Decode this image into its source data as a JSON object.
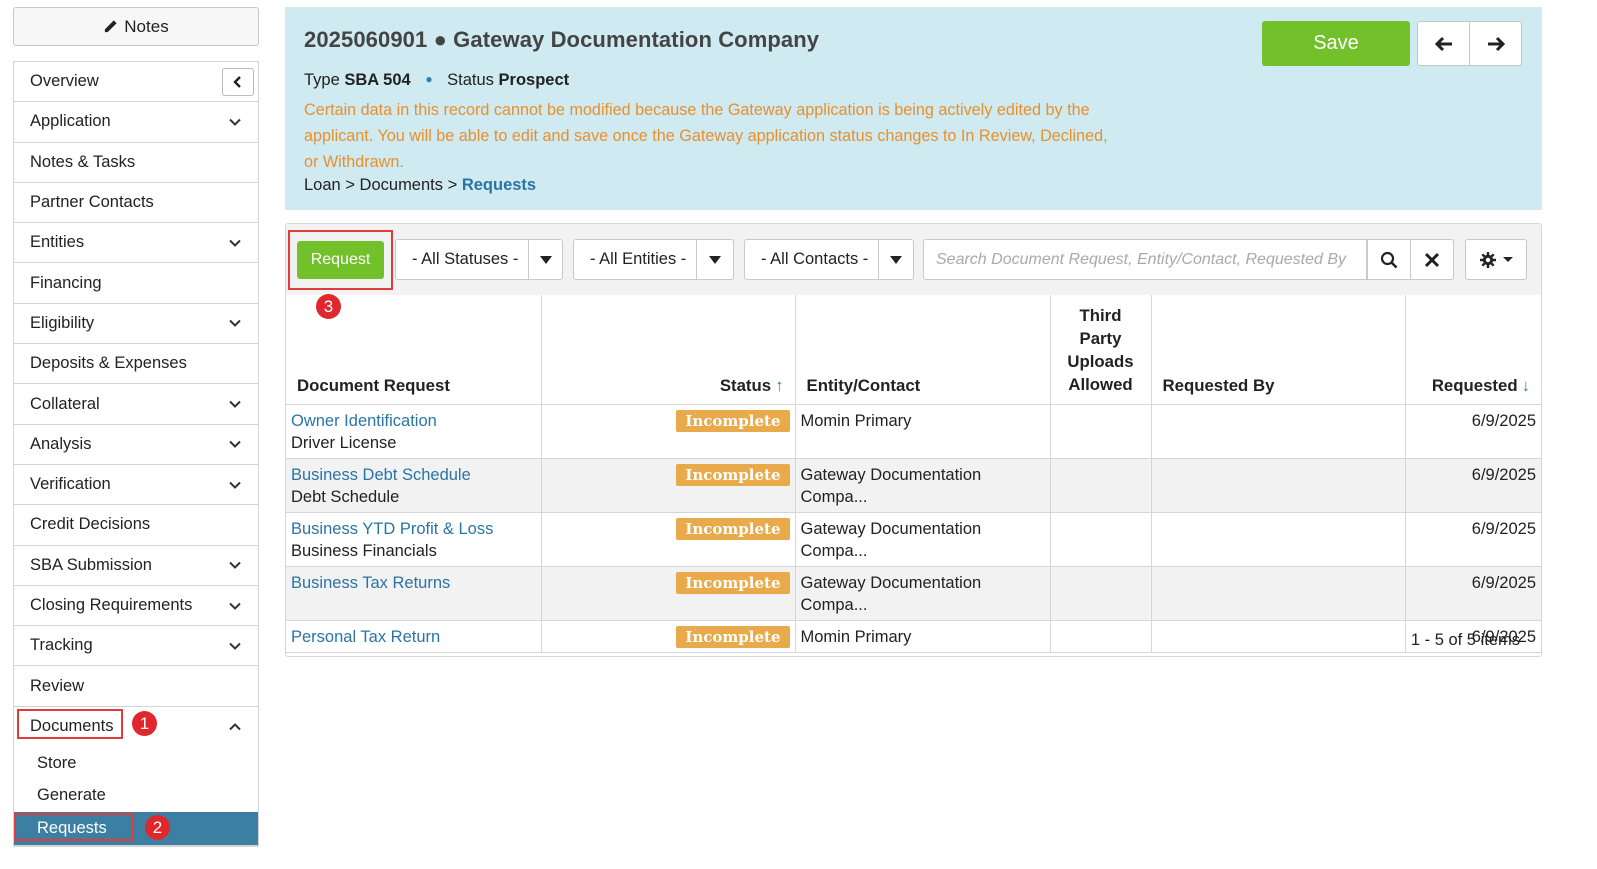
{
  "sidebar": {
    "notes_label": "Notes",
    "items": [
      {
        "label": "Overview"
      },
      {
        "label": "Application"
      },
      {
        "label": "Notes & Tasks"
      },
      {
        "label": "Partner Contacts"
      },
      {
        "label": "Entities"
      },
      {
        "label": "Financing"
      },
      {
        "label": "Eligibility"
      },
      {
        "label": "Deposits & Expenses"
      },
      {
        "label": "Collateral"
      },
      {
        "label": "Analysis"
      },
      {
        "label": "Verification"
      },
      {
        "label": "Credit Decisions"
      },
      {
        "label": "SBA Submission"
      },
      {
        "label": "Closing Requirements"
      },
      {
        "label": "Tracking"
      },
      {
        "label": "Review"
      },
      {
        "label": "Documents"
      }
    ],
    "documents_sub": [
      {
        "label": "Store"
      },
      {
        "label": "Generate"
      },
      {
        "label": "Requests"
      }
    ]
  },
  "annotations": {
    "one": "1",
    "two": "2",
    "three": "3"
  },
  "header": {
    "title": "2025060901 ● Gateway Documentation Company",
    "type_label": "Type",
    "type_value": "SBA 504",
    "status_label": "Status",
    "status_value": "Prospect",
    "warning": "Certain data in this record cannot be modified because the Gateway application is being actively edited by the applicant. You will be able to edit and save once the Gateway application status changes to In Review, Declined, or Withdrawn.",
    "breadcrumb": {
      "part1": "Loan",
      "sep": ">",
      "part2": "Documents",
      "current": "Requests"
    },
    "save_label": "Save"
  },
  "toolbar": {
    "request_label": "Request",
    "statuses_label": "- All Statuses -",
    "entities_label": "- All Entities -",
    "contacts_label": "- All Contacts -",
    "search_placeholder": "Search Document Request, Entity/Contact, Requested By"
  },
  "table": {
    "headers": {
      "document_request": "Document Request",
      "status": "Status",
      "entity_contact": "Entity/Contact",
      "third_party_1": "Third",
      "third_party_2": "Party",
      "third_party_3": "Uploads",
      "third_party_4": "Allowed",
      "requested_by": "Requested By",
      "requested": "Requested"
    },
    "rows": [
      {
        "title": "Owner Identification",
        "subtitle": "Driver License",
        "status": "Incomplete",
        "entity": "Momin Primary",
        "third_party": "",
        "requested_by": "",
        "requested": "6/9/2025"
      },
      {
        "title": "Business Debt Schedule",
        "subtitle": "Debt Schedule",
        "status": "Incomplete",
        "entity": "Gateway Documentation Compa...",
        "third_party": "",
        "requested_by": "",
        "requested": "6/9/2025"
      },
      {
        "title": "Business YTD Profit & Loss",
        "subtitle": "Business Financials",
        "status": "Incomplete",
        "entity": "Gateway Documentation Compa...",
        "third_party": "",
        "requested_by": "",
        "requested": "6/9/2025"
      },
      {
        "title": "Business Tax Returns",
        "subtitle": "",
        "status": "Incomplete",
        "entity": "Gateway Documentation Compa...",
        "third_party": "",
        "requested_by": "",
        "requested": "6/9/2025"
      },
      {
        "title": "Personal Tax Return",
        "subtitle": "",
        "status": "Incomplete",
        "entity": "Momin Primary",
        "third_party": "",
        "requested_by": "",
        "requested": "6/9/2025"
      }
    ],
    "pager": "1 - 5 of 5 items"
  },
  "colors": {
    "accent_green": "#72c12b",
    "header_bg": "#cfeaf1",
    "warning": "#e8902c",
    "link": "#2a74a6",
    "active_nav": "#3d7fa3",
    "status_badge": "#e8aa4a",
    "annotation_red": "#e0272d"
  }
}
